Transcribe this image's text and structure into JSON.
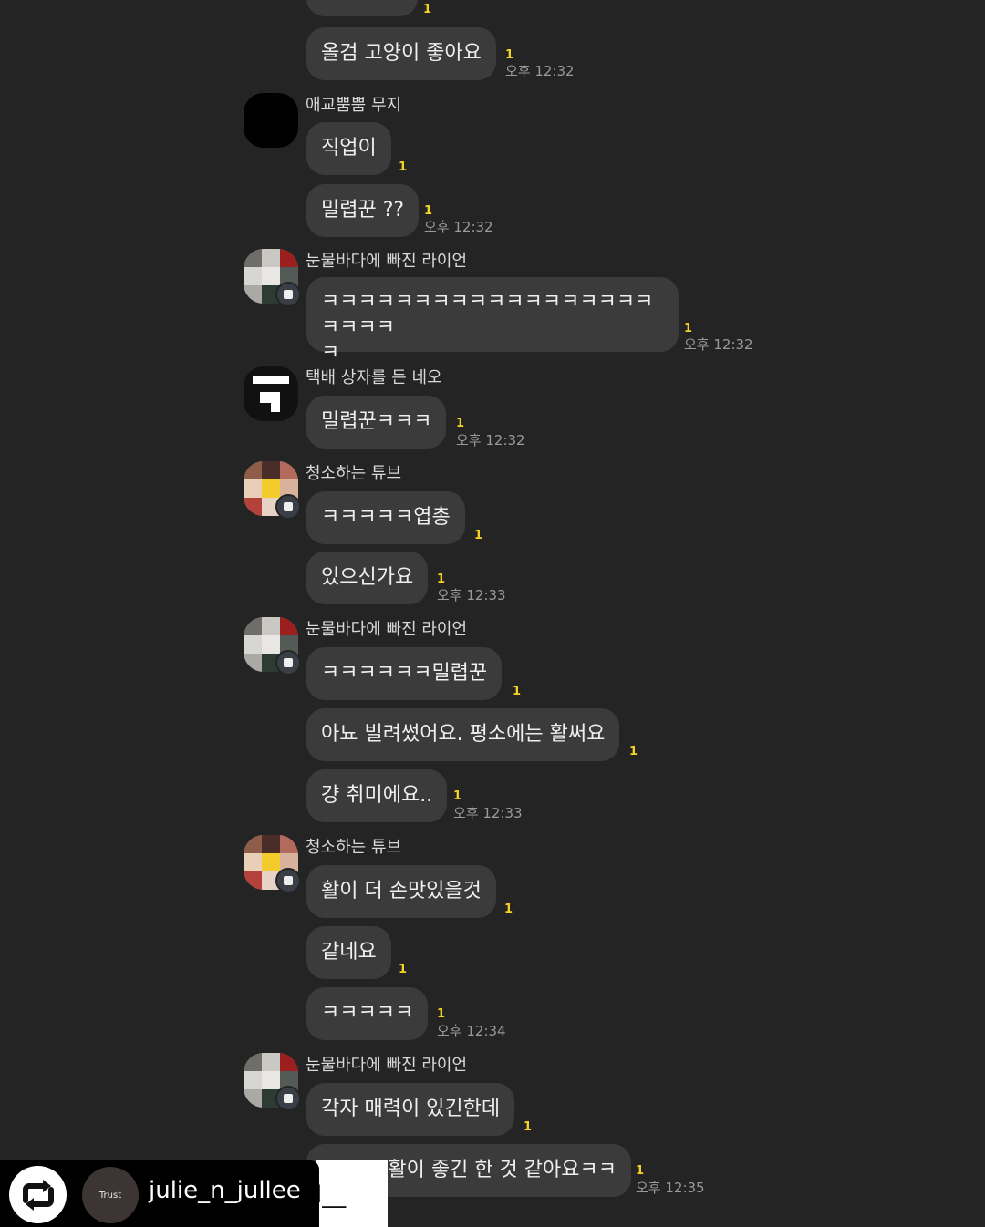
{
  "top_partial": {
    "unread": "1"
  },
  "messages": [
    {
      "text": "올검 고양이 좋아요",
      "unread": "1",
      "time": "오후 12:32"
    },
    {
      "sender": "애교뿜뿜 무지"
    },
    {
      "text": "직업이",
      "unread": "1"
    },
    {
      "text": "밀렵꾼 ??",
      "unread": "1",
      "time": "오후 12:32"
    },
    {
      "sender": "눈물바다에 빠진 라이언"
    },
    {
      "text": "ㅋㅋㅋㅋㅋㅋㅋㅋㅋㅋㅋㅋㅋㅋㅋㅋㅋㅋㅋㅋㅋㅋ\nㅋ",
      "unread": "1",
      "time": "오후 12:32"
    },
    {
      "sender": "택배 상자를 든 네오"
    },
    {
      "text": "밀렵꾼ㅋㅋㅋ",
      "unread": "1",
      "time": "오후 12:32"
    },
    {
      "sender": "청소하는 튜브"
    },
    {
      "text": "ㅋㅋㅋㅋㅋ엽총",
      "unread": "1"
    },
    {
      "text": "있으신가요",
      "unread": "1",
      "time": "오후 12:33"
    },
    {
      "sender": "눈물바다에 빠진 라이언"
    },
    {
      "text": "ㅋㅋㅋㅋㅋㅋ밀렵꾼",
      "unread": "1"
    },
    {
      "text": "아뇨 빌려썼어요. 평소에는 활써요",
      "unread": "1"
    },
    {
      "text": "걍 취미에요..",
      "unread": "1",
      "time": "오후 12:33"
    },
    {
      "sender": "청소하는 튜브"
    },
    {
      "text": "활이 더 손맛있을것",
      "unread": "1"
    },
    {
      "text": "같네요",
      "unread": "1"
    },
    {
      "text": "ㅋㅋㅋㅋㅋ",
      "unread": "1",
      "time": "오후 12:34"
    },
    {
      "sender": "눈물바다에 빠진 라이언"
    },
    {
      "text": "각자 매력이 있긴한데",
      "unread": "1"
    },
    {
      "text": "활이 좋긴 한 것 같아요ㅋㅋ",
      "unread": "1",
      "time": "오후 12:35"
    }
  ],
  "repost": {
    "avatar_text": "Trust",
    "username": "julie_n_jullee",
    "card_text": "l__"
  },
  "colors": {
    "background": "#242424",
    "bubble": "#3b3b3b",
    "unread": "#f5d225"
  }
}
